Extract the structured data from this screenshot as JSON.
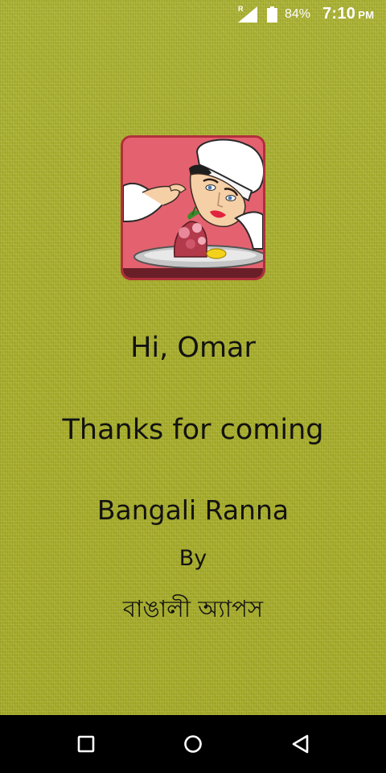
{
  "status_bar": {
    "roaming_indicator": "R",
    "battery_percent": "84%",
    "time": "7:10",
    "ampm": "PM",
    "icons": [
      "signal-icon",
      "battery-icon"
    ],
    "text_color": "#ffffff"
  },
  "logo": {
    "icon": "chef-logo-icon",
    "frame_color": "#b1303a",
    "background_color": "#e4626f"
  },
  "welcome": {
    "greeting": "Hi, Omar",
    "thanks": "Thanks for coming",
    "app_name": "Bangali Ranna",
    "by": "By",
    "developer": "বাঙালী অ্যাপস"
  },
  "nav_bar": {
    "buttons": [
      "recent-apps-icon",
      "home-icon",
      "back-icon"
    ],
    "background_color": "#000000"
  },
  "theme": {
    "background_color": "#a7ad2e",
    "text_color": "#121212"
  }
}
